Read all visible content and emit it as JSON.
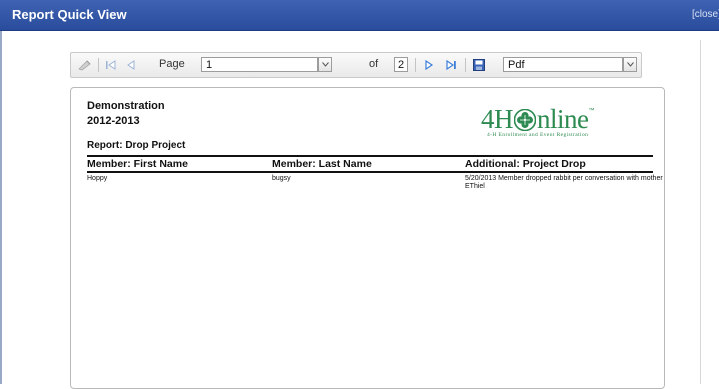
{
  "window": {
    "title": "Report Quick View",
    "close_label": "[close]"
  },
  "toolbar": {
    "page_label": "Page",
    "page_value": "1",
    "of_label": "of",
    "total_pages": "2",
    "format_value": "Pdf",
    "icons": [
      "refresh-icon",
      "first-page-icon",
      "previous-page-icon",
      "next-page-icon",
      "last-page-icon",
      "export-save-icon"
    ]
  },
  "report": {
    "org": "Demonstration",
    "year": "2012-2013",
    "report_name": "Report: Drop Project",
    "logo": {
      "main_text_1": "4H",
      "main_text_2": "nline",
      "tm": "™",
      "subtitle": "4-H Enrollment and Event Registration"
    },
    "columns": [
      "Member: First Name",
      "Member: Last Name",
      "Additional: Project Drop"
    ],
    "rows": [
      [
        "Hoppy",
        "bugsy",
        "5/20/2013 Member dropped rabbit per conversation with mother EThiel"
      ]
    ]
  },
  "colors": {
    "titlebar": "#2f52a6",
    "logo_green": "#2d8a50",
    "nav_icon_blue": "#3d7fd9"
  }
}
